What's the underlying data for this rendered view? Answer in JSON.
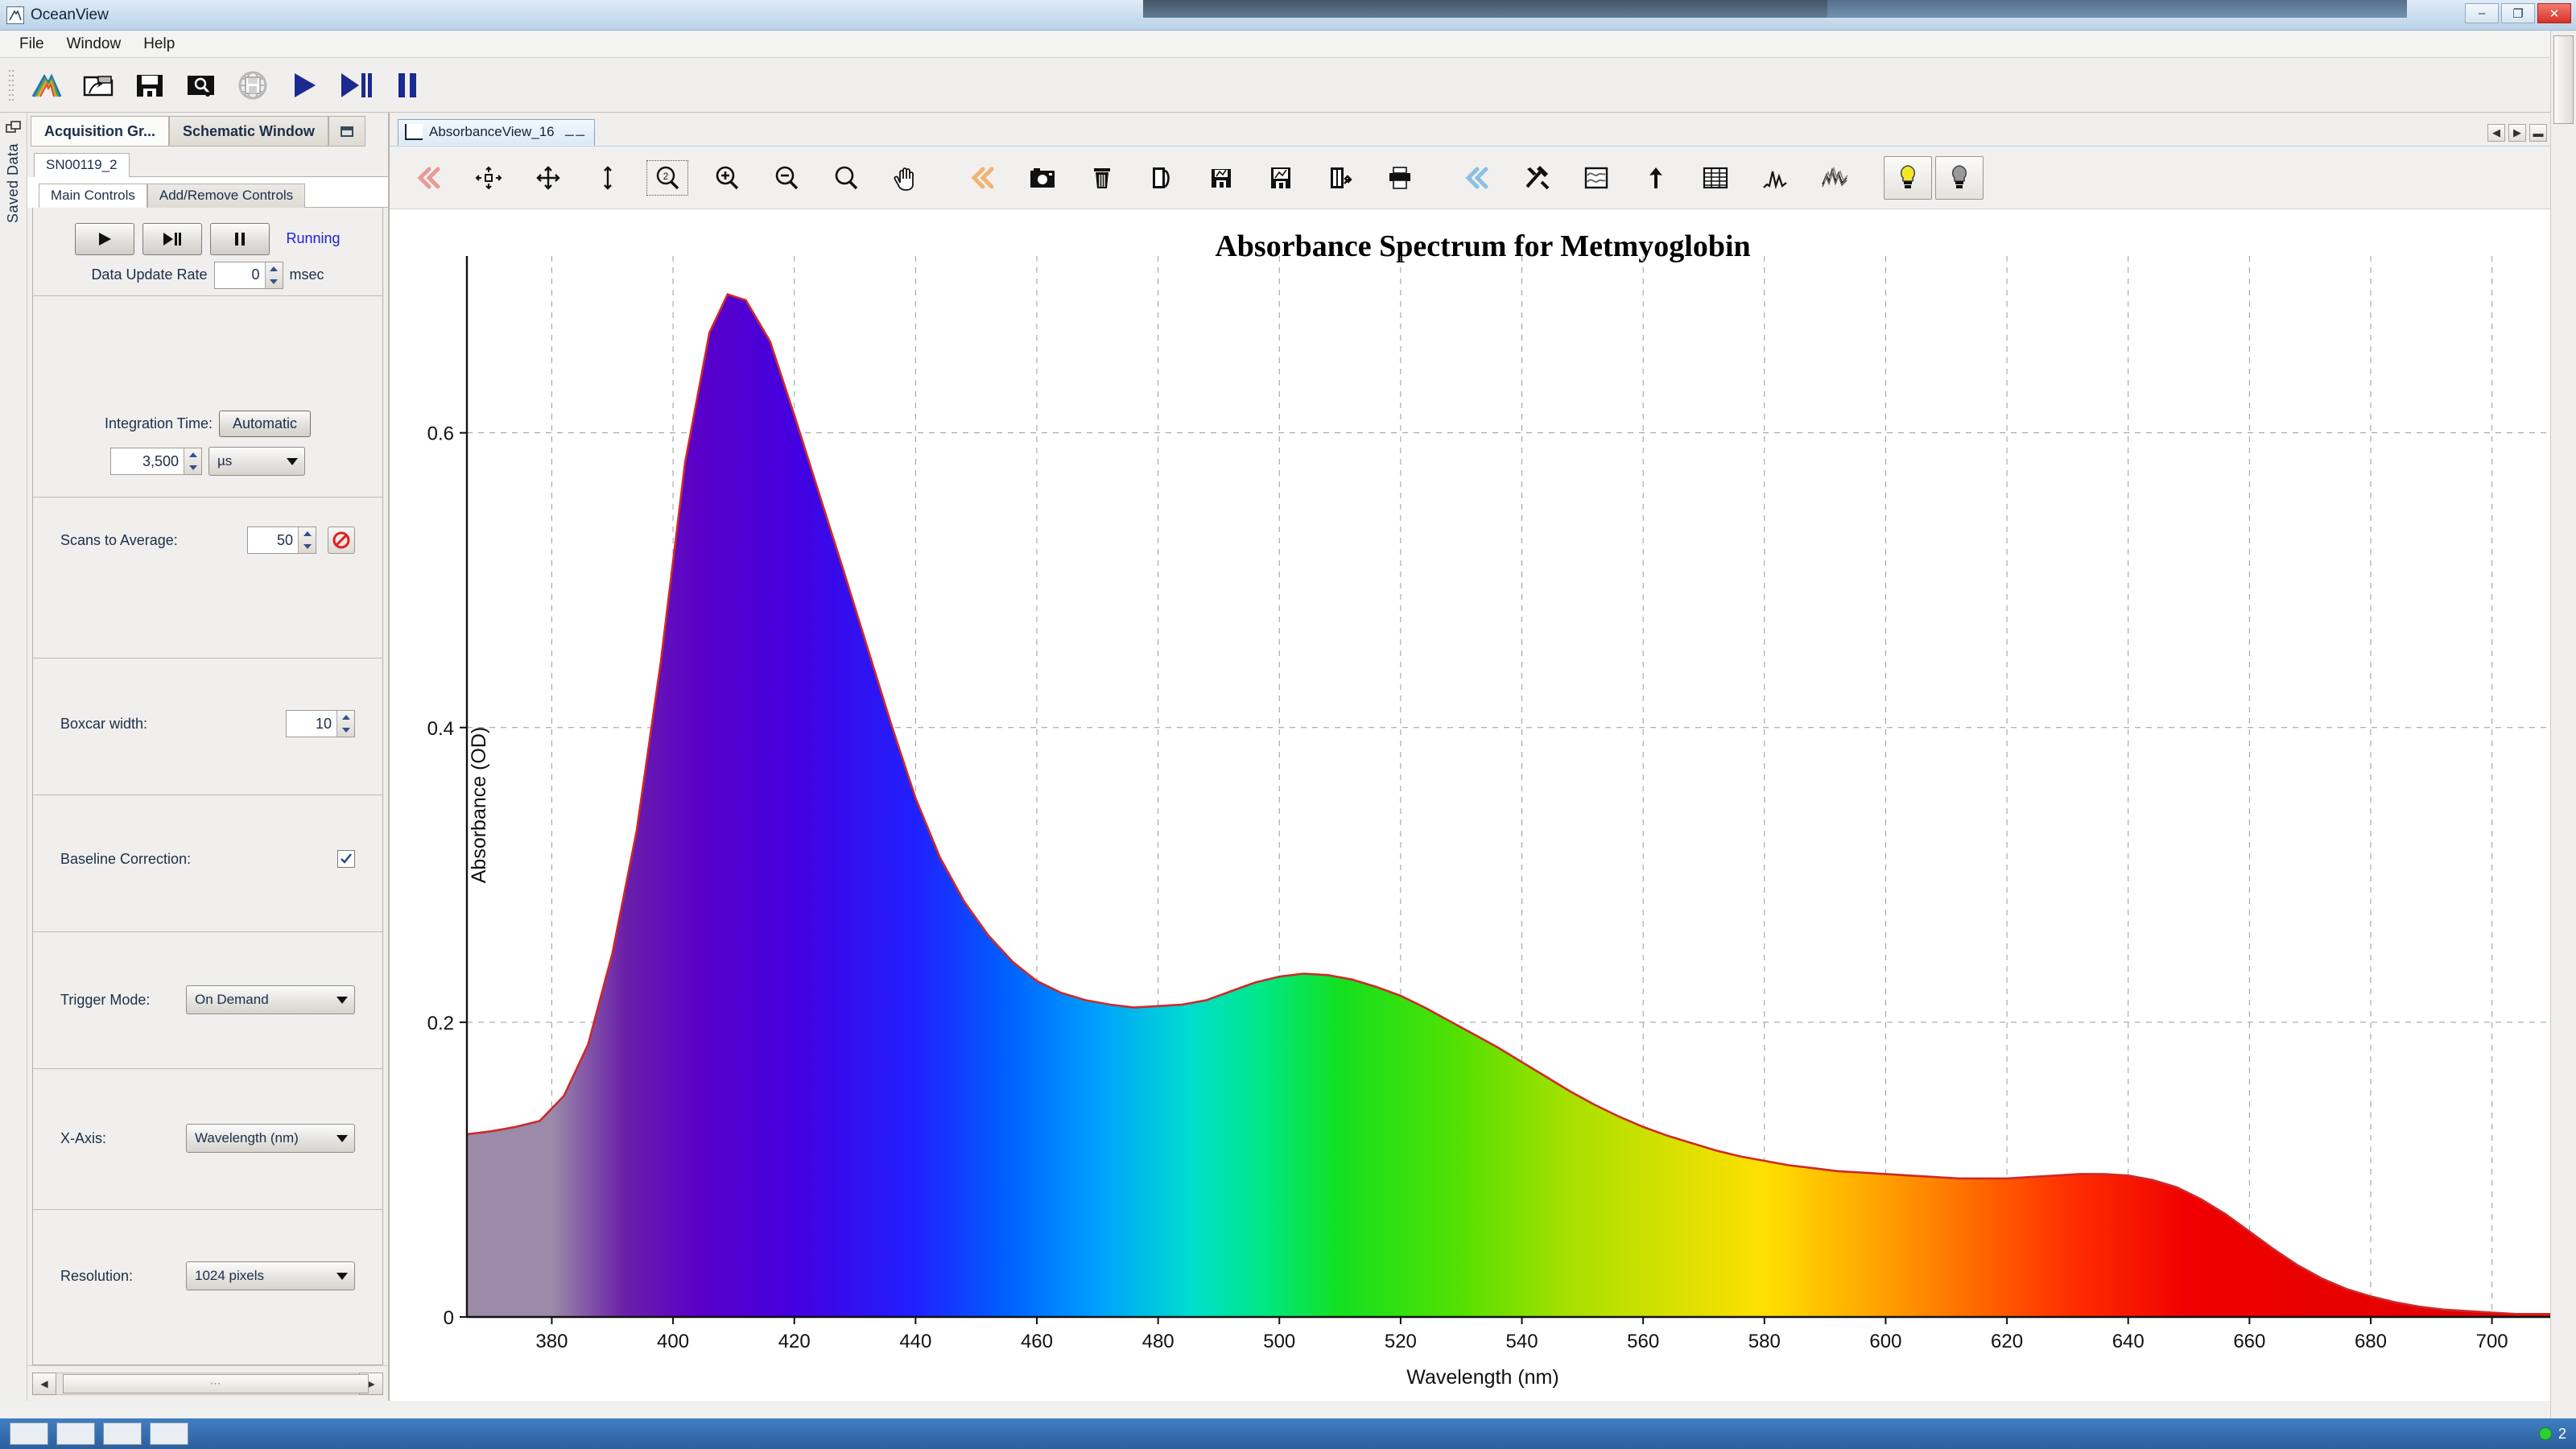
{
  "window": {
    "app_title": "OceanView",
    "app_icon": "oceanview-logo-icon",
    "minimize_label": "–",
    "maximize_label": "❐",
    "close_label": "✕"
  },
  "menubar": {
    "items": [
      "File",
      "Window",
      "Help"
    ]
  },
  "main_toolbar": {
    "buttons": [
      {
        "name": "new-spectrum-icon",
        "tip": "New Spectrum"
      },
      {
        "name": "open-folder-icon",
        "tip": "Open"
      },
      {
        "name": "save-icon",
        "tip": "Save"
      },
      {
        "name": "preview-icon",
        "tip": "Preview"
      },
      {
        "name": "save-web-icon",
        "tip": "Save to Web"
      },
      {
        "name": "play-icon",
        "tip": "Start"
      },
      {
        "name": "play-pause-icon",
        "tip": "Single Scan"
      },
      {
        "name": "pause-icon",
        "tip": "Pause"
      }
    ]
  },
  "rail": {
    "label": "Saved Data",
    "icon": "windows-stack-icon"
  },
  "left_panel": {
    "top_tabs": [
      {
        "label": "Acquisition Gr...",
        "active": true
      },
      {
        "label": "Schematic Window",
        "active": false
      }
    ],
    "top_tab_button": "minimize-panel-icon",
    "device_tab": "SN00119_2",
    "control_tabs": [
      {
        "label": "Main Controls",
        "active": true
      },
      {
        "label": "Add/Remove Controls",
        "active": false
      }
    ],
    "transport": {
      "play_icon": "play-icon",
      "single_icon": "play-pause-icon",
      "pause_icon": "pause-icon",
      "status": "Running"
    },
    "data_update_rate": {
      "label": "Data Update Rate",
      "value": "0",
      "unit": "msec"
    },
    "integration_time": {
      "label": "Integration Time:",
      "button": "Automatic",
      "value": "3,500",
      "unit": "µs"
    },
    "scans_to_average": {
      "label": "Scans to Average:",
      "value": "50",
      "stop_icon": "no-entry-icon"
    },
    "boxcar_width": {
      "label": "Boxcar width:",
      "value": "10"
    },
    "baseline_correction": {
      "label": "Baseline Correction:",
      "checked": true
    },
    "trigger_mode": {
      "label": "Trigger Mode:",
      "value": "On Demand"
    },
    "x_axis": {
      "label": "X-Axis:",
      "value": "Wavelength (nm)"
    },
    "resolution": {
      "label": "Resolution:",
      "value": "1024 pixels"
    },
    "hscroll": {
      "left": "◀",
      "right": "▶",
      "thumb": "⋯"
    }
  },
  "document_tab": {
    "icon": "spectrum-chart-icon",
    "label": "AbsorbanceView_16",
    "close_icon": "close-icon",
    "right_buttons": [
      "prev-icon",
      "next-icon",
      "restore-icon",
      "maximize-icon"
    ]
  },
  "chart_toolbar": {
    "buttons": [
      {
        "name": "collapse-left-icon",
        "tip": "Collapse"
      },
      {
        "name": "autoscale-y-icon",
        "tip": "Autoscale Y"
      },
      {
        "name": "autoscale-xy-icon",
        "tip": "Autoscale X and Y"
      },
      {
        "name": "scale-vertical-icon",
        "tip": "Scale Vertical"
      },
      {
        "name": "zoom-region-icon",
        "tip": "Zoom Region",
        "selected": true
      },
      {
        "name": "zoom-in-icon",
        "tip": "Zoom In"
      },
      {
        "name": "zoom-out-icon",
        "tip": "Zoom Out"
      },
      {
        "name": "zoom-reset-icon",
        "tip": "Zoom Reset"
      },
      {
        "name": "pan-hand-icon",
        "tip": "Pan"
      },
      {
        "name": "collapse-left-orange-icon",
        "tip": "Collapse"
      },
      {
        "name": "camera-snapshot-icon",
        "tip": "Snapshot"
      },
      {
        "name": "delete-trash-icon",
        "tip": "Delete"
      },
      {
        "name": "copy-page-icon",
        "tip": "Copy"
      },
      {
        "name": "save-graph-icon",
        "tip": "Save Graph"
      },
      {
        "name": "save-image-icon",
        "tip": "Save Image"
      },
      {
        "name": "configure-file-icon",
        "tip": "Configure"
      },
      {
        "name": "print-icon",
        "tip": "Print"
      },
      {
        "name": "collapse-left-blue-icon",
        "tip": "Collapse"
      },
      {
        "name": "tools-icon",
        "tip": "Tools"
      },
      {
        "name": "smooth-curve-icon",
        "tip": "Overlay"
      },
      {
        "name": "peak-marker-icon",
        "tip": "Peaks"
      },
      {
        "name": "table-grid-icon",
        "tip": "Table View"
      },
      {
        "name": "peaks-graph-icon",
        "tip": "Peak Graph"
      },
      {
        "name": "multi-trace-icon",
        "tip": "Multiple Traces"
      },
      {
        "name": "lightbulb-on-icon",
        "tip": "Strobe On",
        "framed": true
      },
      {
        "name": "lightbulb-off-icon",
        "tip": "Strobe Off",
        "framed": true
      }
    ]
  },
  "chart_data": {
    "type": "area",
    "title": "Absorbance Spectrum for Metmyoglobin",
    "xlabel": "Wavelength (nm)",
    "ylabel": "Absorbance (OD)",
    "xlim": [
      366,
      712
    ],
    "ylim": [
      0,
      0.72
    ],
    "xticks": [
      380,
      400,
      420,
      440,
      460,
      480,
      500,
      520,
      540,
      560,
      580,
      600,
      620,
      640,
      660,
      680,
      700
    ],
    "yticks": [
      0,
      0.2,
      0.4,
      0.6
    ],
    "grid": true,
    "grid_style": "dashed",
    "legend": "none",
    "line_color": "#cc2a2a",
    "fill": "spectral-rainbow",
    "series": [
      {
        "name": "Absorbance",
        "x": [
          366,
          370,
          374,
          378,
          382,
          386,
          390,
          394,
          398,
          402,
          406,
          409,
          412,
          416,
          420,
          424,
          428,
          432,
          436,
          440,
          444,
          448,
          452,
          456,
          460,
          464,
          468,
          472,
          476,
          480,
          484,
          488,
          492,
          496,
          500,
          504,
          508,
          512,
          516,
          520,
          524,
          528,
          532,
          536,
          540,
          544,
          548,
          552,
          556,
          560,
          564,
          568,
          572,
          576,
          580,
          584,
          588,
          592,
          596,
          600,
          604,
          608,
          612,
          616,
          620,
          624,
          628,
          632,
          636,
          640,
          644,
          648,
          652,
          656,
          660,
          664,
          668,
          672,
          676,
          680,
          684,
          688,
          692,
          696,
          700,
          704,
          708,
          712
        ],
        "y": [
          0.124,
          0.126,
          0.129,
          0.133,
          0.15,
          0.185,
          0.247,
          0.33,
          0.445,
          0.58,
          0.668,
          0.694,
          0.69,
          0.662,
          0.612,
          0.56,
          0.508,
          0.455,
          0.402,
          0.352,
          0.312,
          0.282,
          0.259,
          0.241,
          0.228,
          0.22,
          0.215,
          0.212,
          0.21,
          0.211,
          0.212,
          0.215,
          0.221,
          0.227,
          0.231,
          0.233,
          0.232,
          0.229,
          0.224,
          0.218,
          0.21,
          0.201,
          0.192,
          0.183,
          0.173,
          0.163,
          0.153,
          0.144,
          0.136,
          0.129,
          0.123,
          0.118,
          0.113,
          0.109,
          0.106,
          0.103,
          0.101,
          0.099,
          0.098,
          0.097,
          0.096,
          0.095,
          0.094,
          0.094,
          0.094,
          0.095,
          0.096,
          0.097,
          0.097,
          0.096,
          0.093,
          0.088,
          0.08,
          0.07,
          0.058,
          0.046,
          0.035,
          0.026,
          0.019,
          0.014,
          0.01,
          0.007,
          0.005,
          0.004,
          0.003,
          0.002,
          0.002,
          0.002
        ]
      }
    ]
  },
  "statusbar": {
    "count": "2"
  }
}
